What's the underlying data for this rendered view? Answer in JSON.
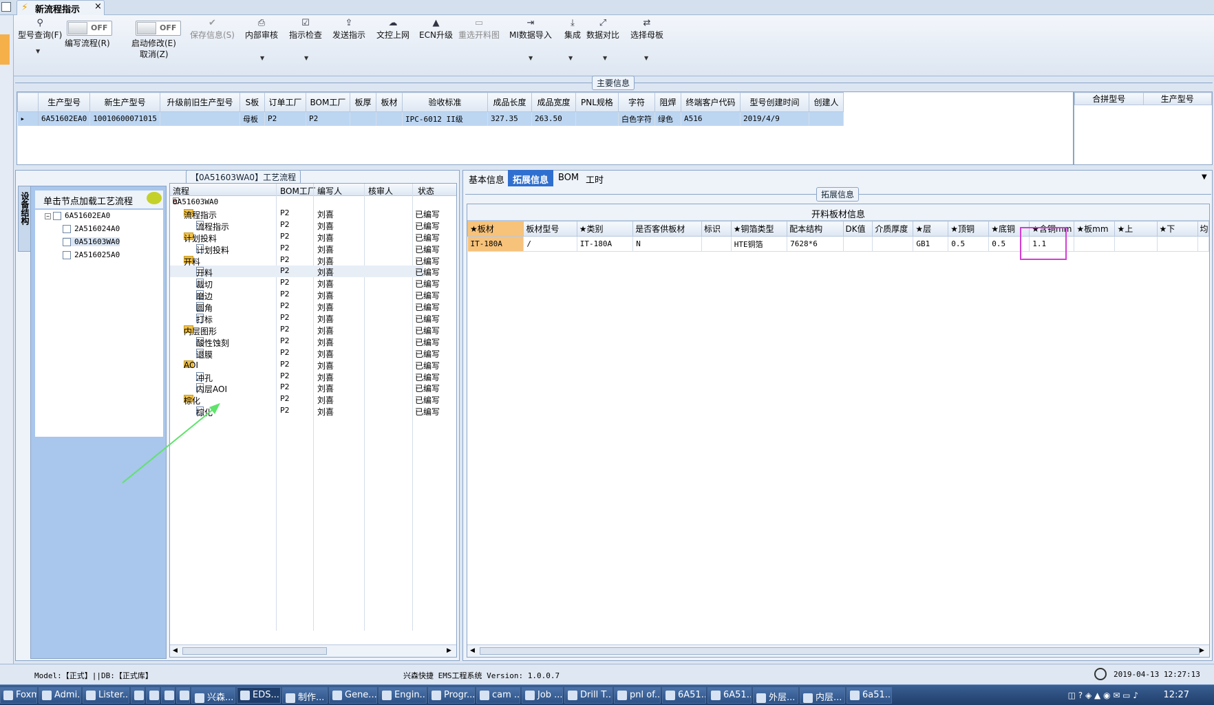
{
  "tab": {
    "title": "新流程指示",
    "close": "×"
  },
  "toolbar": {
    "query": "型号查询(F)",
    "write_flow": "编写流程(R)",
    "toggle_off": "OFF",
    "start_edit": "启动修改(E)",
    "cancel": "取消(Z)",
    "save": "保存信息(S)",
    "internal_review": "内部审核",
    "instr_check": "指示检查",
    "send": "发送指示",
    "doc_upload": "文控上网",
    "ecn": "ECN升级",
    "reselect": "重选开料图",
    "mi_import": "MI数据导入",
    "integrate": "集成",
    "compare": "数据对比",
    "select_master": "选择母板"
  },
  "main_info": {
    "title": "主要信息",
    "headers": [
      "生产型号",
      "新生产型号",
      "升级前旧生产型号",
      "S板",
      "订单工厂",
      "BOM工厂",
      "板厚",
      "板材",
      "验收标准",
      "成品长度",
      "成品宽度",
      "PNL规格",
      "字符",
      "阻焊",
      "终端客户代码",
      "型号创建时间",
      "创建人"
    ],
    "row": [
      "6A51602EA0",
      "10010600071015",
      "",
      "母板",
      "P2",
      "P2",
      "",
      "",
      "IPC-6012 II级",
      "327.35",
      "263.50",
      "",
      "白色字符",
      "绿色",
      "A516",
      "2019/4/9",
      ""
    ],
    "side_headers": [
      "合拼型号",
      "生产型号"
    ]
  },
  "left_panel": {
    "vtab": "设备结构",
    "hint": "单击节点加载工艺流程",
    "tree": [
      "6A51602EA0",
      "2A516024A0",
      "0A51603WA0",
      "2A516025A0"
    ],
    "process_title": "【0A51603WA0】工艺流程",
    "proc_headers": [
      "流程",
      "BOM工厂",
      "编写人",
      "核审人",
      "状态"
    ],
    "root": "0A51603WA0",
    "rows": [
      {
        "name": "流程指示",
        "lvl": 1,
        "type": "folder",
        "bom": "P2",
        "writer": "刘喜",
        "status": "已编写"
      },
      {
        "name": "流程指示",
        "lvl": 2,
        "type": "page",
        "bom": "P2",
        "writer": "刘喜",
        "status": "已编写"
      },
      {
        "name": "计划投料",
        "lvl": 1,
        "type": "folder",
        "bom": "P2",
        "writer": "刘喜",
        "status": "已编写"
      },
      {
        "name": "计划投料",
        "lvl": 2,
        "type": "page",
        "bom": "P2",
        "writer": "刘喜",
        "status": "已编写"
      },
      {
        "name": "开料",
        "lvl": 1,
        "type": "folder",
        "bom": "P2",
        "writer": "刘喜",
        "status": "已编写"
      },
      {
        "name": "开料",
        "lvl": 2,
        "type": "page",
        "bom": "P2",
        "writer": "刘喜",
        "status": "已编写"
      },
      {
        "name": "裁切",
        "lvl": 2,
        "type": "page",
        "bom": "P2",
        "writer": "刘喜",
        "status": "已编写"
      },
      {
        "name": "磨边",
        "lvl": 2,
        "type": "page",
        "bom": "P2",
        "writer": "刘喜",
        "status": "已编写"
      },
      {
        "name": "圆角",
        "lvl": 2,
        "type": "page",
        "bom": "P2",
        "writer": "刘喜",
        "status": "已编写"
      },
      {
        "name": "打标",
        "lvl": 2,
        "type": "page",
        "bom": "P2",
        "writer": "刘喜",
        "status": "已编写"
      },
      {
        "name": "内层图形",
        "lvl": 1,
        "type": "folder",
        "bom": "P2",
        "writer": "刘喜",
        "status": "已编写"
      },
      {
        "name": "酸性蚀刻",
        "lvl": 2,
        "type": "page",
        "bom": "P2",
        "writer": "刘喜",
        "status": "已编写"
      },
      {
        "name": "退膜",
        "lvl": 2,
        "type": "page",
        "bom": "P2",
        "writer": "刘喜",
        "status": "已编写"
      },
      {
        "name": "AOI",
        "lvl": 1,
        "type": "folder",
        "bom": "P2",
        "writer": "刘喜",
        "status": "已编写"
      },
      {
        "name": "冲孔",
        "lvl": 2,
        "type": "page",
        "bom": "P2",
        "writer": "刘喜",
        "status": "已编写"
      },
      {
        "name": "内层AOI",
        "lvl": 2,
        "type": "page",
        "bom": "P2",
        "writer": "刘喜",
        "status": "已编写"
      },
      {
        "name": "棕化",
        "lvl": 1,
        "type": "folder",
        "bom": "P2",
        "writer": "刘喜",
        "status": "已编写"
      },
      {
        "name": "棕化",
        "lvl": 2,
        "type": "page",
        "bom": "P2",
        "writer": "刘喜",
        "status": "已编写"
      }
    ]
  },
  "right_panel": {
    "tabs": [
      "基本信息",
      "拓展信息",
      "BOM",
      "工时"
    ],
    "group": "拓展信息",
    "table_title": "开料板材信息",
    "headers": [
      "★板材",
      "板材型号",
      "★类别",
      "是否客供板材",
      "标识",
      "★铜箔类型",
      "配本结构",
      "DK值",
      "介质厚度",
      "★层",
      "★顶铜",
      "★底铜",
      "★含铜mm",
      "★板mm",
      "★上",
      "★下",
      "均"
    ],
    "row": [
      "IT-180A",
      "/",
      "IT-180A",
      "N",
      "",
      "HTE铜箔",
      "7628*6",
      "",
      "",
      "GB1",
      "0.5",
      "0.5",
      "1.1",
      "",
      "",
      "",
      ""
    ]
  },
  "status": {
    "model": "Model:【正式】||DB:【正式库】",
    "system": "兴森快捷 EMS工程系统 Version: 1.0.0.7",
    "datetime": "2019-04-13 12:27:13"
  },
  "taskbar": {
    "items": [
      "Foxmail",
      "Admi...",
      "Lister...",
      "",
      "",
      "",
      "",
      "兴森...",
      "EDS...",
      "制作...",
      "Gene...",
      "Engin...",
      "Progr...",
      "cam ...",
      "Job ...",
      "Drill T...",
      "pnl of...",
      "6A51...",
      "6A51...",
      "外层...",
      "内层...",
      "6a51..."
    ],
    "clock": "12:27"
  },
  "colors": {
    "accent": "#2f6fcf",
    "highlight_box": "#d63bd6",
    "arrow": "#5fe36a"
  }
}
